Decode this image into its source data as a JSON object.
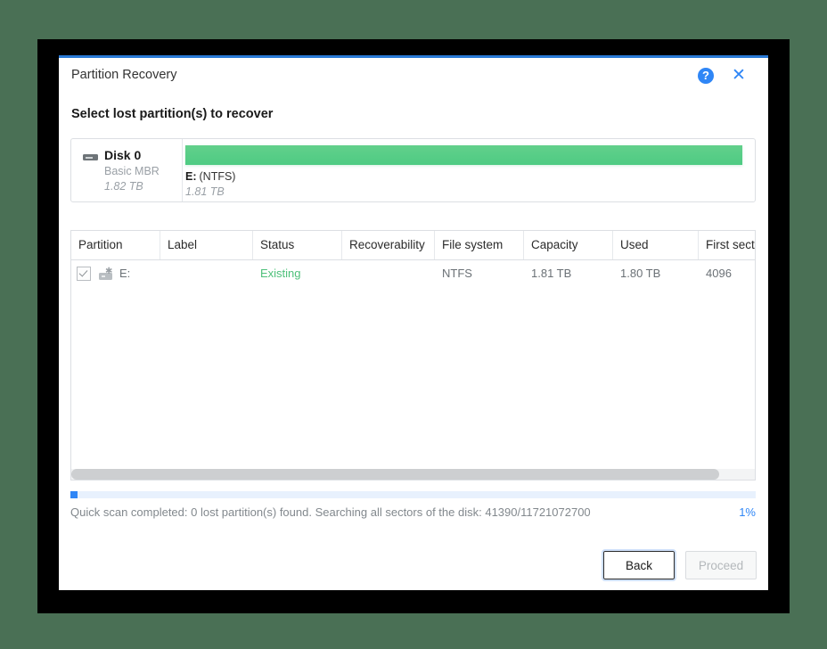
{
  "window": {
    "title": "Partition Recovery",
    "help_icon": "help-circle-icon",
    "help_glyph": "?",
    "close_icon": "close-icon",
    "close_glyph": "✕"
  },
  "heading": "Select lost partition(s) to recover",
  "disk_panel": {
    "name": "Disk 0",
    "scheme": "Basic MBR",
    "size": "1.82 TB",
    "disk_icon": "hard-disk-icon",
    "map": {
      "partition_letter": "E:",
      "partition_fs": "(NTFS)",
      "partition_size": "1.81 TB",
      "bar_color": "#4ecb83",
      "bar_fill_percent": 99
    }
  },
  "table": {
    "columns": [
      "Partition",
      "Label",
      "Status",
      "Recoverability",
      "File system",
      "Capacity",
      "Used",
      "First sector"
    ],
    "rows": [
      {
        "checked": true,
        "partition": "E:",
        "label": "",
        "status": "Existing",
        "status_color": "#4ec07a",
        "recoverability": "",
        "file_system": "NTFS",
        "capacity": "1.81 TB",
        "used": "1.80 TB",
        "first_sector": "4096"
      }
    ]
  },
  "progress": {
    "percent_value": 1,
    "percent_label": "1%",
    "status_text": "Quick scan completed: 0 lost partition(s) found. Searching all sectors of the disk: 41390/11721072700",
    "fill_color": "#2f86f6",
    "track_color": "#e8f1fd"
  },
  "footer": {
    "back_label": "Back",
    "proceed_label": "Proceed"
  }
}
